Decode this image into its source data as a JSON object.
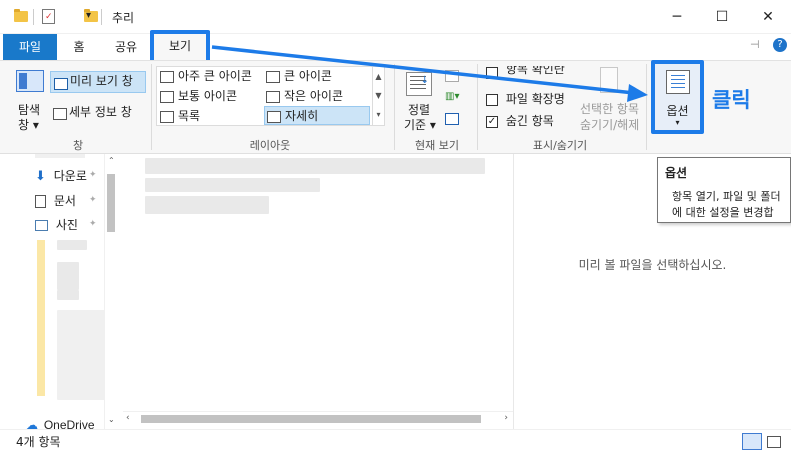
{
  "window": {
    "title": "추리",
    "minimize_icon": "─",
    "maximize_icon": "☐",
    "close_icon": "✕"
  },
  "ribbon_tabs": {
    "file": "파일",
    "home": "홈",
    "share": "공유",
    "view": "보기",
    "help_icon": "?"
  },
  "panes_group": {
    "nav_pane": "탐색",
    "nav_pane2": "창",
    "preview_pane": "미리 보기 창",
    "details_pane": "세부 정보 창",
    "label": "창"
  },
  "layout_group": {
    "extra_large": "아주 큰 아이콘",
    "large": "큰 아이콘",
    "medium": "보통 아이콘",
    "small": "작은 아이콘",
    "list": "목록",
    "details": "자세히",
    "label": "레이아웃"
  },
  "current_view_group": {
    "sort_line1": "정렬",
    "sort_line2": "기준",
    "label": "현재 보기"
  },
  "show_hide_group": {
    "item_checkboxes": "항목 확인란",
    "file_extensions": "파일 확장명",
    "hidden_items": "숨긴 항목",
    "hide_selected_line1": "선택한 항목",
    "hide_selected_line2": "숨기기/해제",
    "label": "표시/숨기기",
    "checks": {
      "item_checkboxes": false,
      "file_extensions": false,
      "hidden_items": true
    }
  },
  "options": {
    "label": "옵션",
    "annotation": "클릭",
    "tooltip_title": "옵션",
    "tooltip_line1": "항목 열기, 파일 및 폴더",
    "tooltip_line2": "에 대한 설정을 변경합"
  },
  "nav_pane": {
    "items": [
      {
        "label": "다운로"
      },
      {
        "label": "문서"
      },
      {
        "label": "사진"
      }
    ],
    "onedrive": "OneDrive"
  },
  "preview": {
    "empty_text": "미리 볼 파일을 선택하십시오."
  },
  "status": {
    "item_count": "4개 항목"
  },
  "colors": {
    "accent": "#1d7be8",
    "file_tab": "#1979ca",
    "annotation": "#1d7be8"
  }
}
